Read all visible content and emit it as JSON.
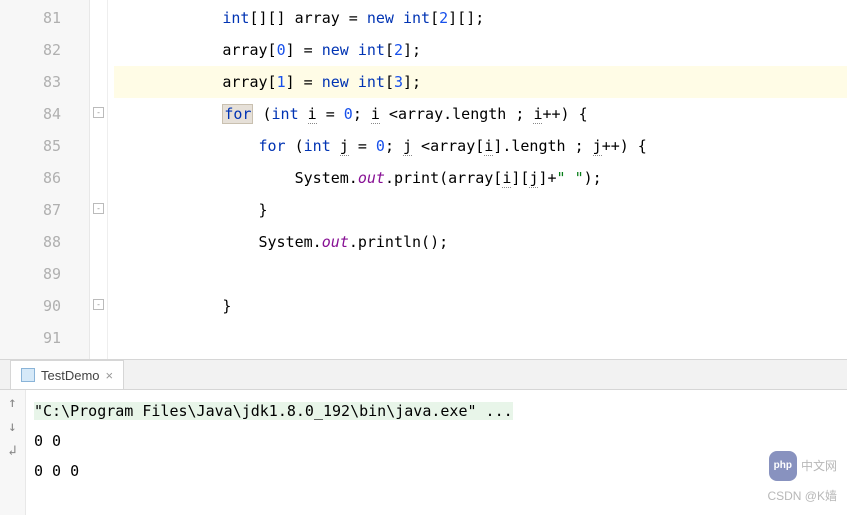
{
  "lines": [
    {
      "num": "81",
      "marker": false
    },
    {
      "num": "82",
      "marker": false
    },
    {
      "num": "83",
      "marker": false
    },
    {
      "num": "84",
      "marker": true
    },
    {
      "num": "85",
      "marker": false
    },
    {
      "num": "86",
      "marker": false
    },
    {
      "num": "87",
      "marker": true
    },
    {
      "num": "88",
      "marker": false
    },
    {
      "num": "89",
      "marker": false
    },
    {
      "num": "90",
      "marker": true
    },
    {
      "num": "91",
      "marker": false
    }
  ],
  "code": {
    "l81": {
      "pre": "            ",
      "kw1": "int",
      "t1": "[][] array = ",
      "kw2": "new int",
      "t2": "[",
      "n1": "2",
      "t3": "][];"
    },
    "l82": {
      "pre": "            array[",
      "n1": "0",
      "t1": "] = ",
      "kw1": "new int",
      "t2": "[",
      "n2": "2",
      "t3": "];"
    },
    "l83": {
      "pre": "            array[",
      "n1": "1",
      "t1": "] = ",
      "kw1": "new int",
      "t2": "[",
      "n2": "3",
      "t3": "];"
    },
    "l84": {
      "pre": "            ",
      "kw1": "for",
      "t1": " (",
      "kw2": "int",
      "t2": " ",
      "v1": "i",
      "t3": " = ",
      "n1": "0",
      "t4": "; ",
      "v2": "i",
      "t5": " <array.length ; ",
      "v3": "i",
      "t6": "++) {"
    },
    "l85": {
      "pre": "                ",
      "kw1": "for",
      "t1": " (",
      "kw2": "int",
      "t2": " ",
      "v1": "j",
      "t3": " = ",
      "n1": "0",
      "t4": "; ",
      "v2": "j",
      "t5": " <array[",
      "v3": "i",
      "t6": "].length ; ",
      "v4": "j",
      "t7": "++) {"
    },
    "l86": {
      "pre": "                    System.",
      "f1": "out",
      "t1": ".print(array[",
      "v1": "i",
      "t2": "][",
      "v2": "j",
      "t3": "]+",
      "s1": "\" \"",
      "t4": ");"
    },
    "l87": {
      "pre": "                }"
    },
    "l88": {
      "pre": "                System.",
      "f1": "out",
      "t1": ".println();"
    },
    "l89": {
      "pre": ""
    },
    "l90": {
      "pre": "            }"
    },
    "l91": {
      "pre": ""
    }
  },
  "tab": {
    "name": "TestDemo"
  },
  "console": {
    "cmd": "\"C:\\Program Files\\Java\\jdk1.8.0_192\\bin\\java.exe\" ...",
    "out1": "0 0",
    "out2": "0 0 0"
  },
  "watermark": {
    "badge": "php",
    "text1": "中文网",
    "text2": "CSDN @K嫱"
  }
}
